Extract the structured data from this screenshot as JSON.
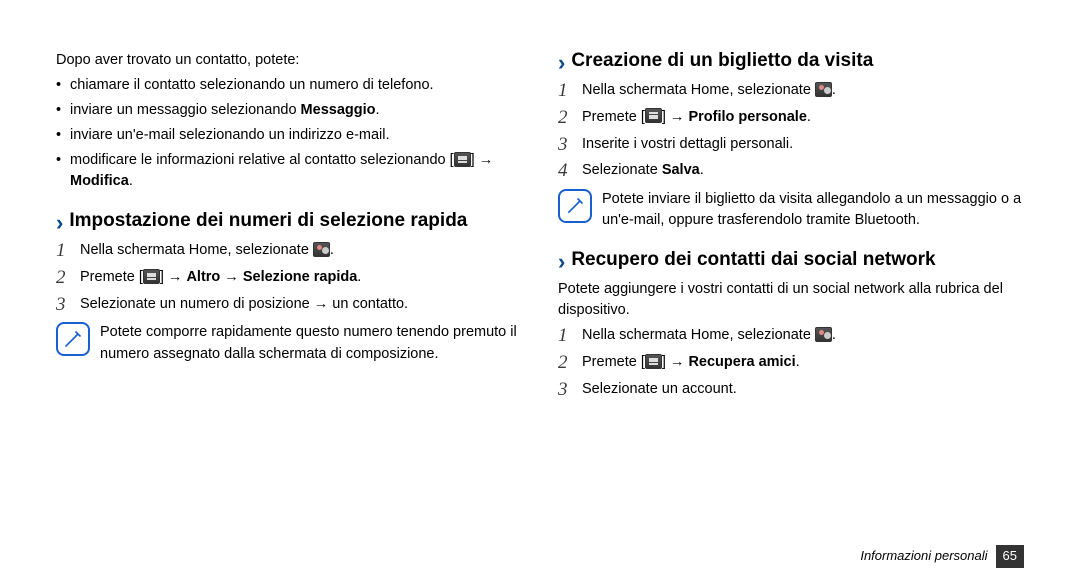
{
  "left": {
    "intro": "Dopo aver trovato un contatto, potete:",
    "bullets": [
      {
        "text": "chiamare il contatto selezionando un numero di telefono."
      },
      {
        "pre": "inviare un messaggio selezionando ",
        "bold": "Messaggio",
        "post": "."
      },
      {
        "text": "inviare un'e-mail selezionando un indirizzo e-mail."
      },
      {
        "pre": "modificare le informazioni relative al contatto selezionando [",
        "mid": "] → ",
        "bold": "Modifica",
        "post": "."
      }
    ],
    "heading": "Impostazione dei numeri di selezione rapida",
    "steps": [
      {
        "n": "1",
        "pre": "Nella schermata Home, selezionate ",
        "post": "."
      },
      {
        "n": "2",
        "pre": "Premete [",
        "mid": "] → ",
        "bold": "Altro → Selezione rapida",
        "post": "."
      },
      {
        "n": "3",
        "text": "Selezionate un numero di posizione → un contatto."
      }
    ],
    "note": "Potete comporre rapidamente questo numero tenendo premuto il numero assegnato dalla schermata di composizione."
  },
  "right": {
    "heading1": "Creazione di un biglietto da visita",
    "steps1": [
      {
        "n": "1",
        "pre": "Nella schermata Home, selezionate ",
        "post": "."
      },
      {
        "n": "2",
        "pre": "Premete [",
        "mid": "] → ",
        "bold": "Profilo personale",
        "post": "."
      },
      {
        "n": "3",
        "text": "Inserite i vostri dettagli personali."
      },
      {
        "n": "4",
        "pre": "Selezionate ",
        "bold": "Salva",
        "post": "."
      }
    ],
    "note": "Potete inviare il biglietto da visita allegandolo a un messaggio o a un'e-mail, oppure trasferendolo tramite Bluetooth.",
    "heading2": "Recupero dei contatti dai social network",
    "subtext": "Potete aggiungere i vostri contatti di un social network alla rubrica del dispositivo.",
    "steps2": [
      {
        "n": "1",
        "pre": "Nella schermata Home, selezionate ",
        "post": "."
      },
      {
        "n": "2",
        "pre": "Premete [",
        "mid": "] → ",
        "bold": "Recupera amici",
        "post": "."
      },
      {
        "n": "3",
        "text": "Selezionate un account."
      }
    ]
  },
  "footer": {
    "section": "Informazioni personali",
    "page": "65"
  }
}
